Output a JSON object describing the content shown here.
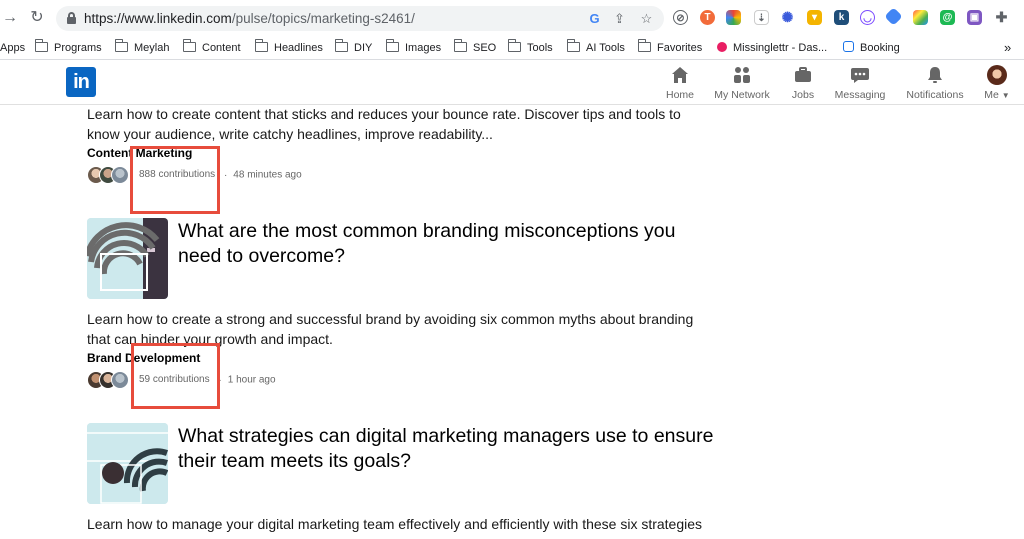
{
  "browser": {
    "url_host": "https://www.linkedin.com",
    "url_path": "/pulse/topics/marketing-s2461/",
    "bookmarks": [
      {
        "label": "Apps",
        "type": "apps"
      },
      {
        "label": "Programs",
        "type": "folder"
      },
      {
        "label": "Meylah",
        "type": "folder"
      },
      {
        "label": "Content",
        "type": "folder"
      },
      {
        "label": "Headlines",
        "type": "folder"
      },
      {
        "label": "DIY",
        "type": "folder"
      },
      {
        "label": "Images",
        "type": "folder"
      },
      {
        "label": "SEO",
        "type": "folder"
      },
      {
        "label": "Tools",
        "type": "folder"
      },
      {
        "label": "AI Tools",
        "type": "folder"
      },
      {
        "label": "Favorites",
        "type": "folder"
      },
      {
        "label": "Missinglettr - Das...",
        "type": "site"
      },
      {
        "label": "Booking",
        "type": "site"
      }
    ],
    "more_bookmarks": "»"
  },
  "linkedin_nav": {
    "logo": "in",
    "items": [
      {
        "label": "Home",
        "icon": "home-icon"
      },
      {
        "label": "My Network",
        "icon": "network-icon"
      },
      {
        "label": "Jobs",
        "icon": "briefcase-icon"
      },
      {
        "label": "Messaging",
        "icon": "chat-icon"
      },
      {
        "label": "Notifications",
        "icon": "bell-icon"
      },
      {
        "label": "Me",
        "icon": "avatar"
      }
    ]
  },
  "articles": [
    {
      "description": "Learn how to create content that sticks and reduces your bounce rate. Discover tips and tools to know your audience, write catchy headlines, improve readability...",
      "topic": "Content Marketing",
      "contributions": "888 contributions",
      "separator": "·",
      "time": "48 minutes ago"
    },
    {
      "title": "What are the most common branding misconceptions you need to overcome?",
      "description": "Learn how to create a strong and successful brand by avoiding six common myths about branding that can hinder your growth and impact.",
      "topic": "Brand Development",
      "contributions": "59 contributions",
      "separator": "·",
      "time": "1 hour ago"
    },
    {
      "title": "What strategies can digital marketing managers use to ensure their team meets its goals?",
      "description": "Learn how to manage your digital marketing team effectively and efficiently with these six strategies"
    }
  ],
  "colors": {
    "linkedin_blue": "#0a66c2",
    "highlight_red": "#e74c3c"
  }
}
